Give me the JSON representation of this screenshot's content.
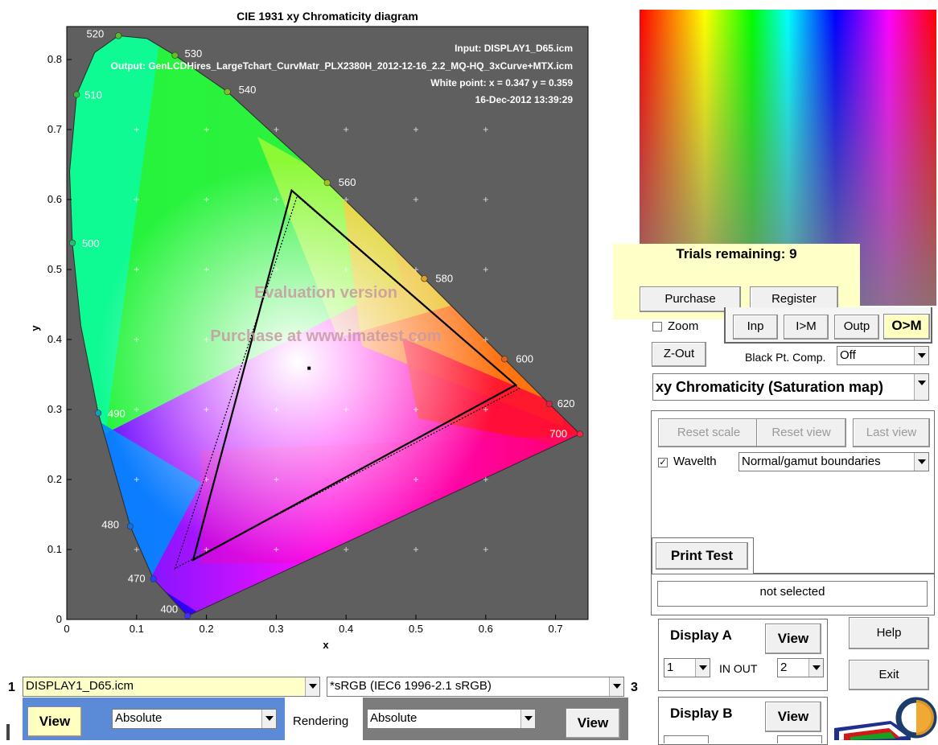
{
  "chart": {
    "title": "CIE 1931 xy Chromaticity diagram",
    "xlabel": "x",
    "ylabel": "y",
    "info": {
      "input": "Input:  DISPLAY1_D65.icm",
      "output": "Output: GenLCDHires_LargeTchart_CurvMatr_PLX2380H_2012-12-16_2.2_MQ-HQ_3xCurve+MTX.icm",
      "white_point": "White point:  x = 0.347  y = 0.359",
      "date": "16-Dec-2012 13:39:29"
    },
    "watermark1": "Evaluation version",
    "watermark2": "Purchase at www.imatest.com",
    "x_ticks": [
      "0",
      "0.1",
      "0.2",
      "0.3",
      "0.4",
      "0.5",
      "0.6",
      "0.7"
    ],
    "y_ticks": [
      "0",
      "0.1",
      "0.2",
      "0.3",
      "0.4",
      "0.5",
      "0.6",
      "0.7",
      "0.8"
    ],
    "wavelength_labels": [
      "400",
      "470",
      "480",
      "490",
      "500",
      "510",
      "520",
      "530",
      "540",
      "560",
      "580",
      "600",
      "620",
      "700"
    ]
  },
  "chart_data": {
    "type": "scatter",
    "title": "CIE 1931 xy Chromaticity diagram",
    "xlabel": "x",
    "ylabel": "y",
    "xlim": [
      0,
      0.74
    ],
    "ylim": [
      0,
      0.84
    ],
    "spectral_locus_points": [
      {
        "label": "400",
        "x": 0.173,
        "y": 0.005
      },
      {
        "label": "470",
        "x": 0.124,
        "y": 0.058
      },
      {
        "label": "480",
        "x": 0.091,
        "y": 0.133
      },
      {
        "label": "490",
        "x": 0.045,
        "y": 0.295
      },
      {
        "label": "500",
        "x": 0.008,
        "y": 0.538
      },
      {
        "label": "510",
        "x": 0.014,
        "y": 0.75
      },
      {
        "label": "520",
        "x": 0.074,
        "y": 0.834
      },
      {
        "label": "530",
        "x": 0.155,
        "y": 0.806
      },
      {
        "label": "540",
        "x": 0.23,
        "y": 0.754
      },
      {
        "label": "560",
        "x": 0.373,
        "y": 0.624
      },
      {
        "label": "580",
        "x": 0.512,
        "y": 0.487
      },
      {
        "label": "600",
        "x": 0.627,
        "y": 0.372
      },
      {
        "label": "620",
        "x": 0.691,
        "y": 0.308
      },
      {
        "label": "700",
        "x": 0.735,
        "y": 0.265
      }
    ],
    "gamut_solid": [
      [
        0.322,
        0.613
      ],
      [
        0.643,
        0.335
      ],
      [
        0.181,
        0.085
      ]
    ],
    "gamut_dotted": [
      [
        0.33,
        0.605
      ],
      [
        0.648,
        0.33
      ],
      [
        0.155,
        0.073
      ]
    ],
    "white_point": {
      "x": 0.347,
      "y": 0.359
    },
    "grid": true
  },
  "controls": {
    "trials": "Trials remaining: 9",
    "purchase": "Purchase",
    "register": "Register",
    "zoom": "Zoom",
    "inp": "Inp",
    "i_to_m": "I>M",
    "outp": "Outp",
    "o_to_m": "O>M",
    "zout": "Z-Out",
    "black_pt": "Black Pt. Comp.",
    "black_pt_value": "Off",
    "plot_select": "xy Chromaticity (Saturation map)",
    "reset_scale": "Reset scale",
    "reset_view": "Reset view",
    "last_view": "Last view",
    "wavelth": "Wavelth",
    "wavelth_checked": "✓",
    "boundaries": "Normal/gamut boundaries",
    "print_test": "Print Test",
    "not_selected": "not selected",
    "display_a": "Display A",
    "display_b": "Display B",
    "view": "View",
    "display_a_in": "1",
    "in_out": "IN  OUT",
    "display_a_out": "2",
    "help": "Help",
    "exit": "Exit"
  },
  "bottom": {
    "num1": "1",
    "num3": "3",
    "profile1": "DISPLAY1_D65.icm",
    "profile3": "*sRGB  (IEC6 1996-2.1 sRGB)",
    "view": "View",
    "intent_left": "Absolute",
    "rendering": "Rendering",
    "intent_right": "Absolute"
  }
}
